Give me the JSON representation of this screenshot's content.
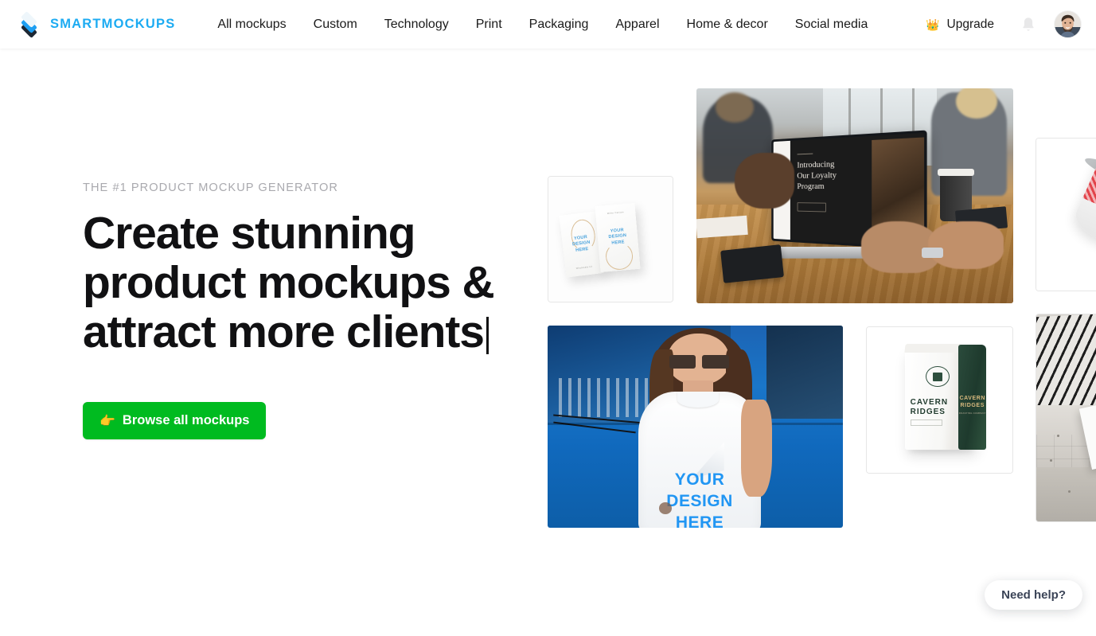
{
  "header": {
    "brand": {
      "name": "SMARTMOCKUPS",
      "logo_icon": "layers-stack-icon",
      "accent": "#1cabf2"
    },
    "nav": [
      {
        "label": "All mockups"
      },
      {
        "label": "Custom"
      },
      {
        "label": "Technology"
      },
      {
        "label": "Print"
      },
      {
        "label": "Packaging"
      },
      {
        "label": "Apparel"
      },
      {
        "label": "Home & decor"
      },
      {
        "label": "Social media"
      }
    ],
    "upgrade": {
      "label": "Upgrade",
      "icon": "crown-icon",
      "icon_glyph": "👑"
    },
    "notifications": {
      "icon": "bell-icon"
    },
    "avatar": {
      "icon": "user-avatar"
    }
  },
  "hero": {
    "eyebrow": "THE #1 PRODUCT MOCKUP GENERATOR",
    "headline_line1": "Create stunning",
    "headline_line2": "product mockups &",
    "headline_line3": "attract more clients",
    "typing_caret": true,
    "cta": {
      "label": "Browse all mockups",
      "icon": "pointing-right-hand-icon",
      "icon_glyph": "👉",
      "color": "#00bb20"
    }
  },
  "gallery": {
    "items": [
      {
        "name": "business-cards-mockup",
        "overlay_text": "YOUR DESIGN HERE",
        "framed": true
      },
      {
        "name": "laptop-meeting-mockup",
        "screen_title": "Introducing Our Loyalty Program",
        "framed": false
      },
      {
        "name": "paper-cup-mockup",
        "framed": true
      },
      {
        "name": "tshirt-woman-van-mockup",
        "overlay_text": "YOUR DESIGN HERE",
        "framed": false
      },
      {
        "name": "coffee-bag-mockup",
        "brand_line1": "CAVERN",
        "brand_line2": "RIDGES",
        "brand_sub": "ROASTING COMPANY",
        "framed": true
      },
      {
        "name": "architectural-sign-mockup",
        "framed": true
      }
    ],
    "cards_card1_tiny": "Wholesale kit",
    "cards_card2_tiny": "Miller Canyon"
  },
  "support": {
    "label": "Need help?"
  }
}
